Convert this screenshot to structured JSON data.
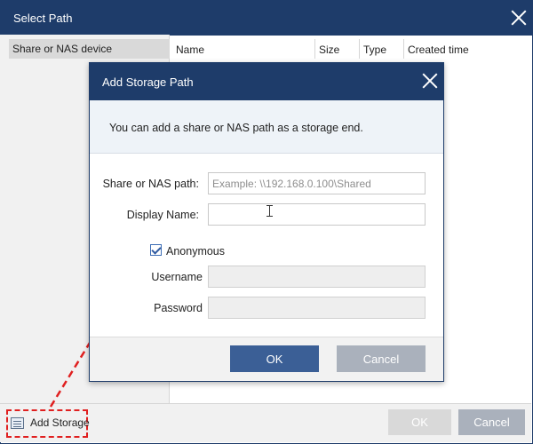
{
  "window": {
    "title": "Select Path",
    "close_icon": "close-icon"
  },
  "left_pane": {
    "header": "Share or NAS device"
  },
  "columns": [
    "Name",
    "Size",
    "Type",
    "Created time"
  ],
  "bottom": {
    "add_storage_label": "Add Storage",
    "add_storage_icon": "storage-list-icon",
    "ok_label": "OK",
    "cancel_label": "Cancel"
  },
  "dialog": {
    "title": "Add Storage Path",
    "intro": "You can add a share or NAS path as a storage end.",
    "share_path_label": "Share or NAS path:",
    "share_path_value": "",
    "share_path_placeholder": "Example: \\\\192.168.0.100\\Shared",
    "display_name_label": "Display Name:",
    "display_name_value": "",
    "anonymous_label": "Anonymous",
    "anonymous_checked": true,
    "username_label": "Username",
    "password_label": "Password",
    "ok_label": "OK",
    "cancel_label": "Cancel"
  },
  "colors": {
    "titlebar": "#1e3c6a",
    "primary_button": "#3b5f96",
    "secondary_button": "#aab1bc",
    "annotation_red": "#e02020"
  }
}
